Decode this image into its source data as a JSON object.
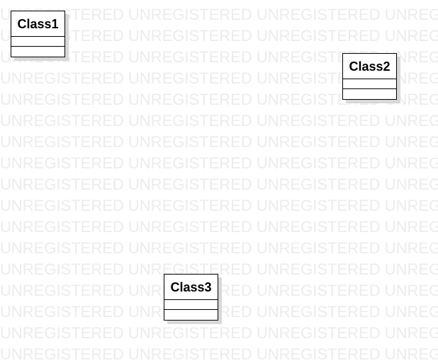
{
  "diagram": {
    "watermark_text": "UNREGISTERED UNREGISTERED UNREGISTERED UNREGISTERED",
    "classes": [
      {
        "name": "Class1",
        "attributes": [],
        "operations": []
      },
      {
        "name": "Class2",
        "attributes": [],
        "operations": []
      },
      {
        "name": "Class3",
        "attributes": [],
        "operations": []
      }
    ]
  },
  "colors": {
    "background": "#ffffff",
    "watermark": "#ececec",
    "border": "#000000",
    "shadow": "#d8d8d8"
  }
}
